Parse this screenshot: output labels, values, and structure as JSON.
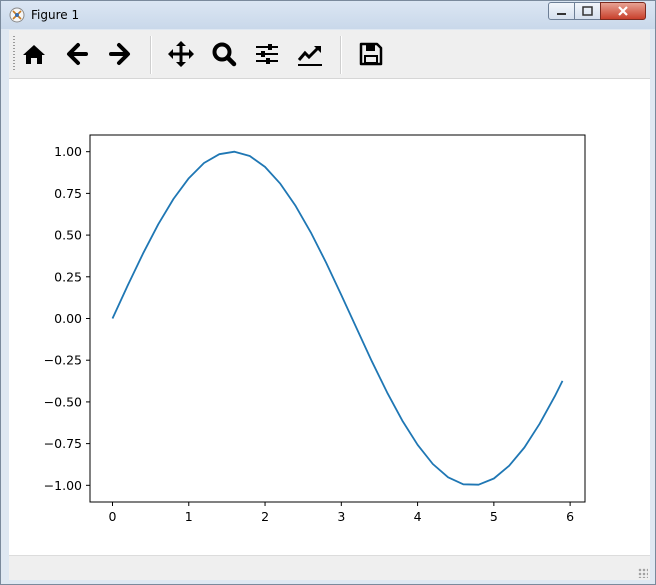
{
  "window": {
    "title": "Figure 1"
  },
  "toolbar": {
    "buttons": [
      {
        "icon": "home-icon"
      },
      {
        "icon": "arrow-left-icon"
      },
      {
        "icon": "arrow-right-icon"
      },
      {
        "icon": "pan-move-icon"
      },
      {
        "icon": "zoom-magnifier-icon"
      },
      {
        "icon": "subplots-sliders-icon"
      },
      {
        "icon": "edit-axis-chart-icon"
      },
      {
        "icon": "save-floppy-icon"
      }
    ]
  },
  "chart_data": {
    "type": "line",
    "title": "",
    "xlabel": "",
    "ylabel": "",
    "xlim": [
      -0.295,
      6.195
    ],
    "ylim": [
      -1.1,
      1.1
    ],
    "xticks": [
      "0",
      "1",
      "2",
      "3",
      "4",
      "5",
      "6"
    ],
    "yticks": [
      "1.00",
      "0.75",
      "0.50",
      "0.25",
      "0.00",
      "−0.25",
      "−0.50",
      "−0.75",
      "−1.00"
    ],
    "grid": false,
    "series": [
      {
        "color": "#1f77b4",
        "x": [
          0.0,
          0.2,
          0.4,
          0.6,
          0.8,
          1.0,
          1.2,
          1.4,
          1.6,
          1.8,
          2.0,
          2.2,
          2.4,
          2.6,
          2.8,
          3.0,
          3.2,
          3.4,
          3.6,
          3.8,
          4.0,
          4.2,
          4.4,
          4.6,
          4.8,
          5.0,
          5.2,
          5.4,
          5.6,
          5.8,
          5.9
        ],
        "y": [
          0.0,
          0.199,
          0.389,
          0.565,
          0.717,
          0.841,
          0.932,
          0.985,
          1.0,
          0.974,
          0.909,
          0.808,
          0.675,
          0.516,
          0.335,
          0.141,
          -0.058,
          -0.256,
          -0.443,
          -0.612,
          -0.757,
          -0.872,
          -0.952,
          -0.994,
          -0.996,
          -0.959,
          -0.883,
          -0.773,
          -0.631,
          -0.465,
          -0.374
        ]
      }
    ]
  }
}
